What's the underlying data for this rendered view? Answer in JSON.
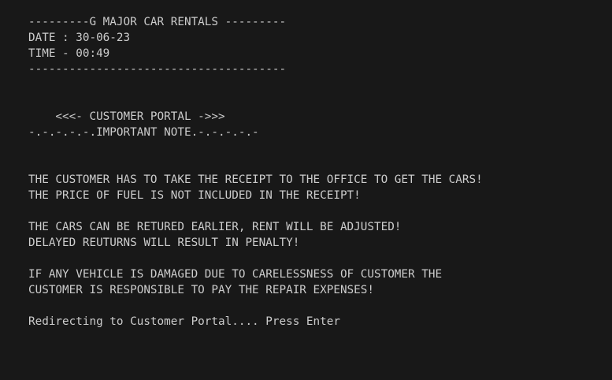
{
  "terminal": {
    "lines": [
      "---------G MAJOR CAR RENTALS ---------",
      "DATE : 30-06-23",
      "TIME - 00:49",
      "--------------------------------------",
      "",
      "",
      "    <<<- CUSTOMER PORTAL ->>>",
      "-.-.-.-.-.IMPORTANT NOTE.-.-.-.-.-",
      "",
      "",
      "THE CUSTOMER HAS TO TAKE THE RECEIPT TO THE OFFICE TO GET THE CARS!",
      "THE PRICE OF FUEL IS NOT INCLUDED IN THE RECEIPT!",
      "",
      "THE CARS CAN BE RETURED EARLIER, RENT WILL BE ADJUSTED!",
      "DELAYED REUTURNS WILL RESULT IN PENALTY!",
      "",
      "IF ANY VEHICLE IS DAMAGED DUE TO CARELESSNESS OF CUSTOMER THE",
      "CUSTOMER IS RESPONSIBLE TO PAY THE REPAIR EXPENSES!",
      "",
      "Redirecting to Customer Portal.... Press Enter"
    ],
    "colors": {
      "background": "#181818",
      "text": "#cccccc"
    }
  }
}
